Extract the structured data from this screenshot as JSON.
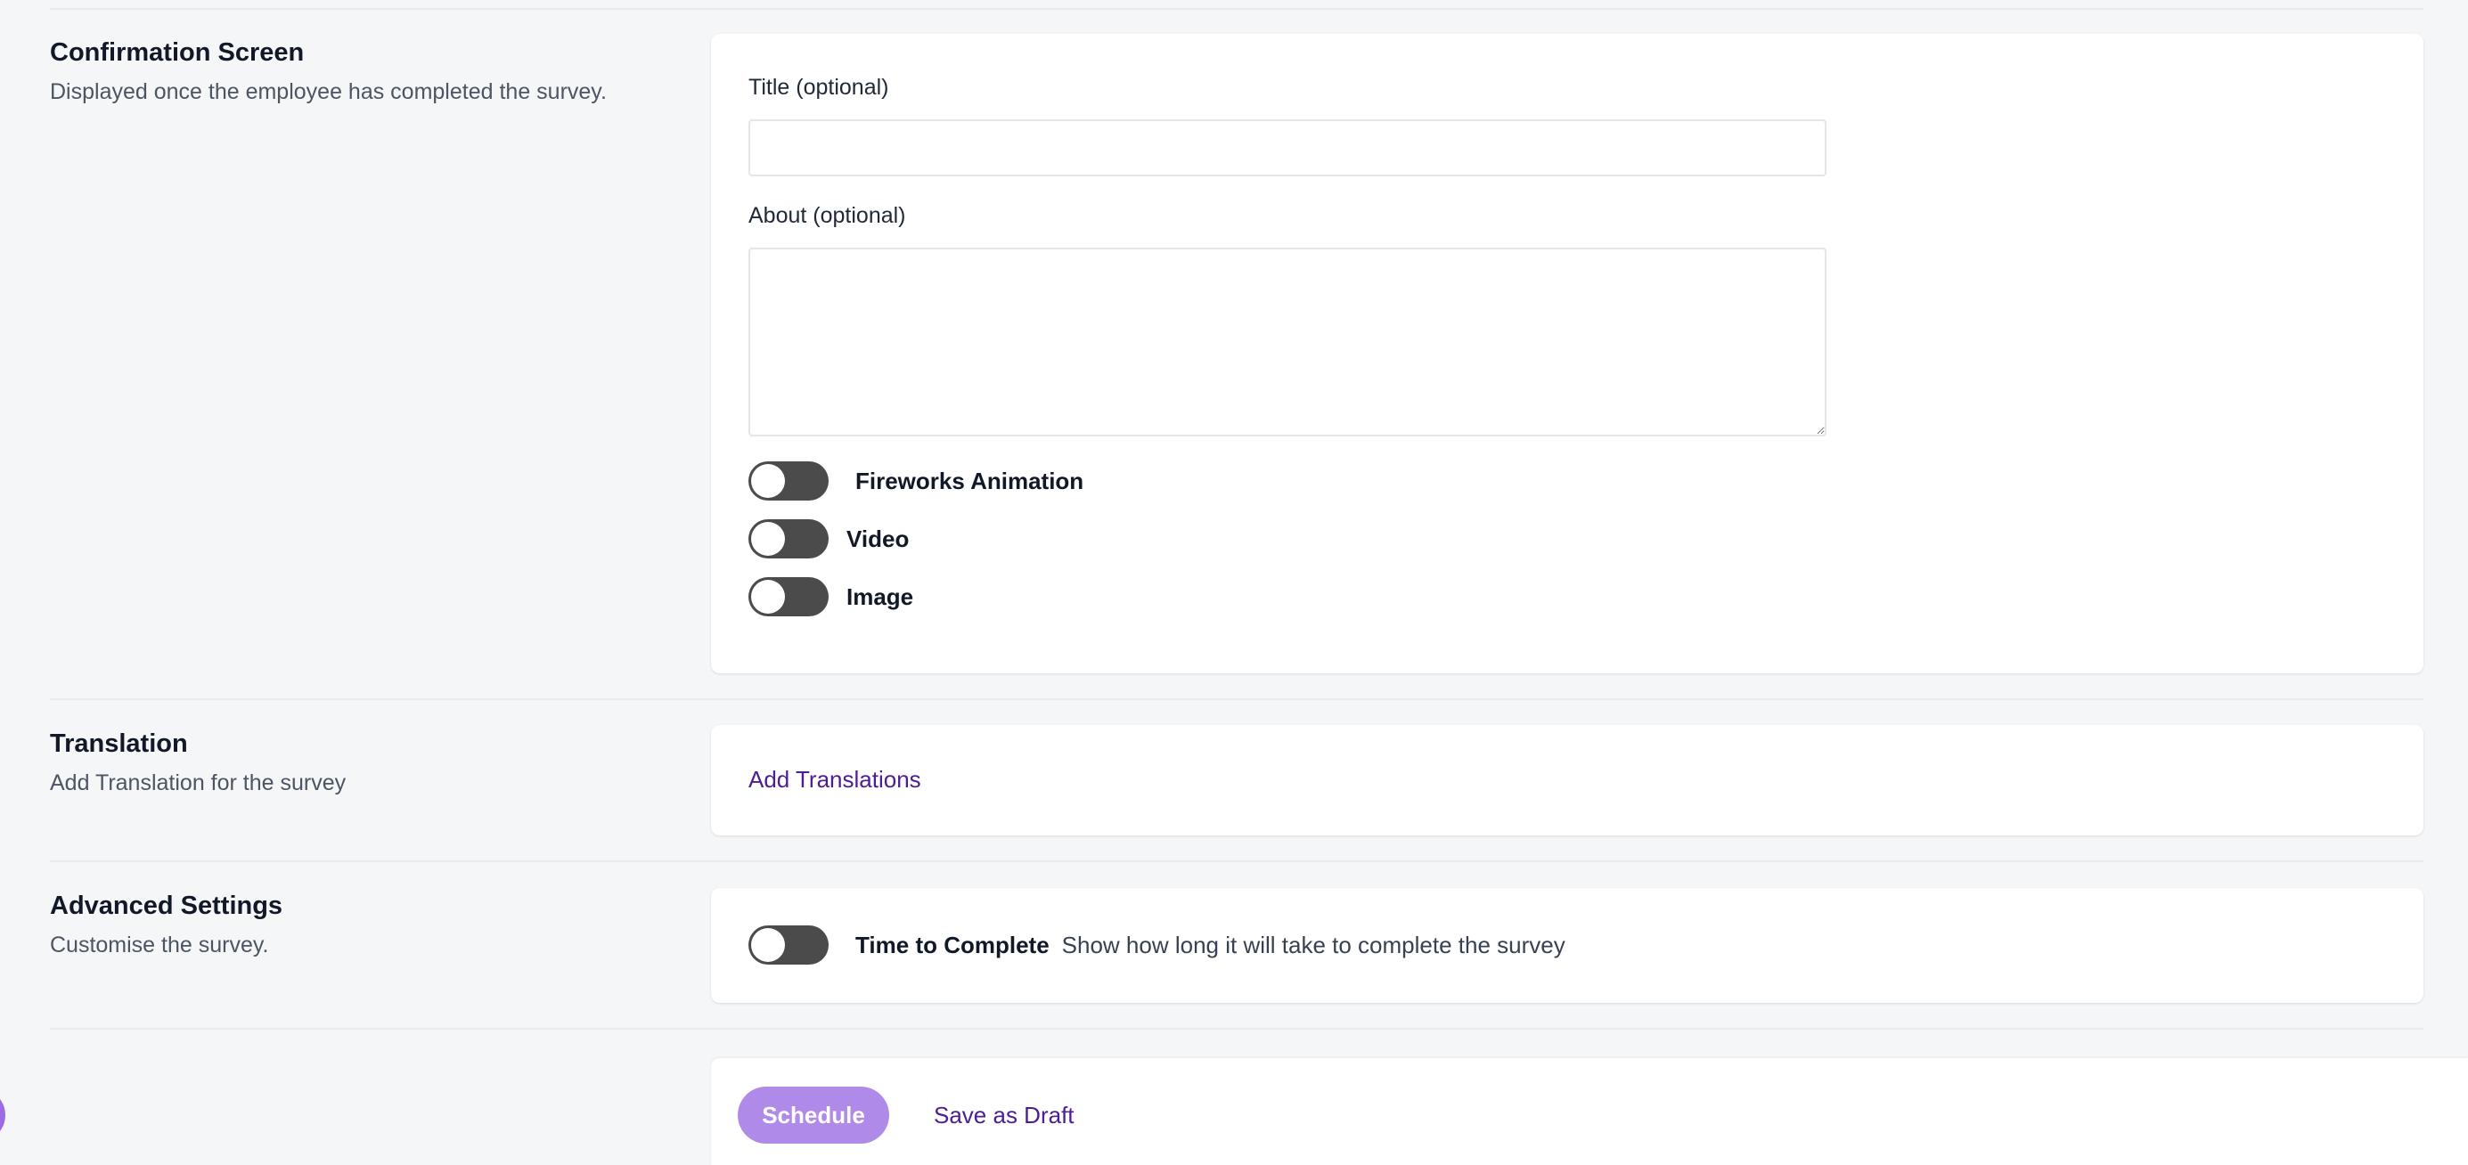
{
  "confirmation": {
    "title": "Confirmation Screen",
    "description": "Displayed once the employee has completed the survey.",
    "title_field": {
      "label": "Title (optional)",
      "value": "",
      "placeholder": ""
    },
    "about_field": {
      "label": "About (optional)",
      "value": "",
      "placeholder": ""
    },
    "toggles": [
      {
        "label": "Fireworks Animation",
        "on": false
      },
      {
        "label": "Video",
        "on": false
      },
      {
        "label": "Image",
        "on": false
      }
    ]
  },
  "translation": {
    "title": "Translation",
    "description": "Add Translation for the survey",
    "add_link": "Add Translations"
  },
  "advanced": {
    "title": "Advanced Settings",
    "description": "Customise the survey.",
    "toggle": {
      "label": "Time to Complete",
      "description": "Show how long it will take to complete the survey",
      "on": false
    }
  },
  "footer": {
    "schedule_label": "Schedule",
    "draft_label": "Save as Draft"
  },
  "colors": {
    "background": "#f5f6f8",
    "toggle_off": "#4b4b4b",
    "accent_button": "#b08ae8",
    "link": "#4c1d95"
  }
}
